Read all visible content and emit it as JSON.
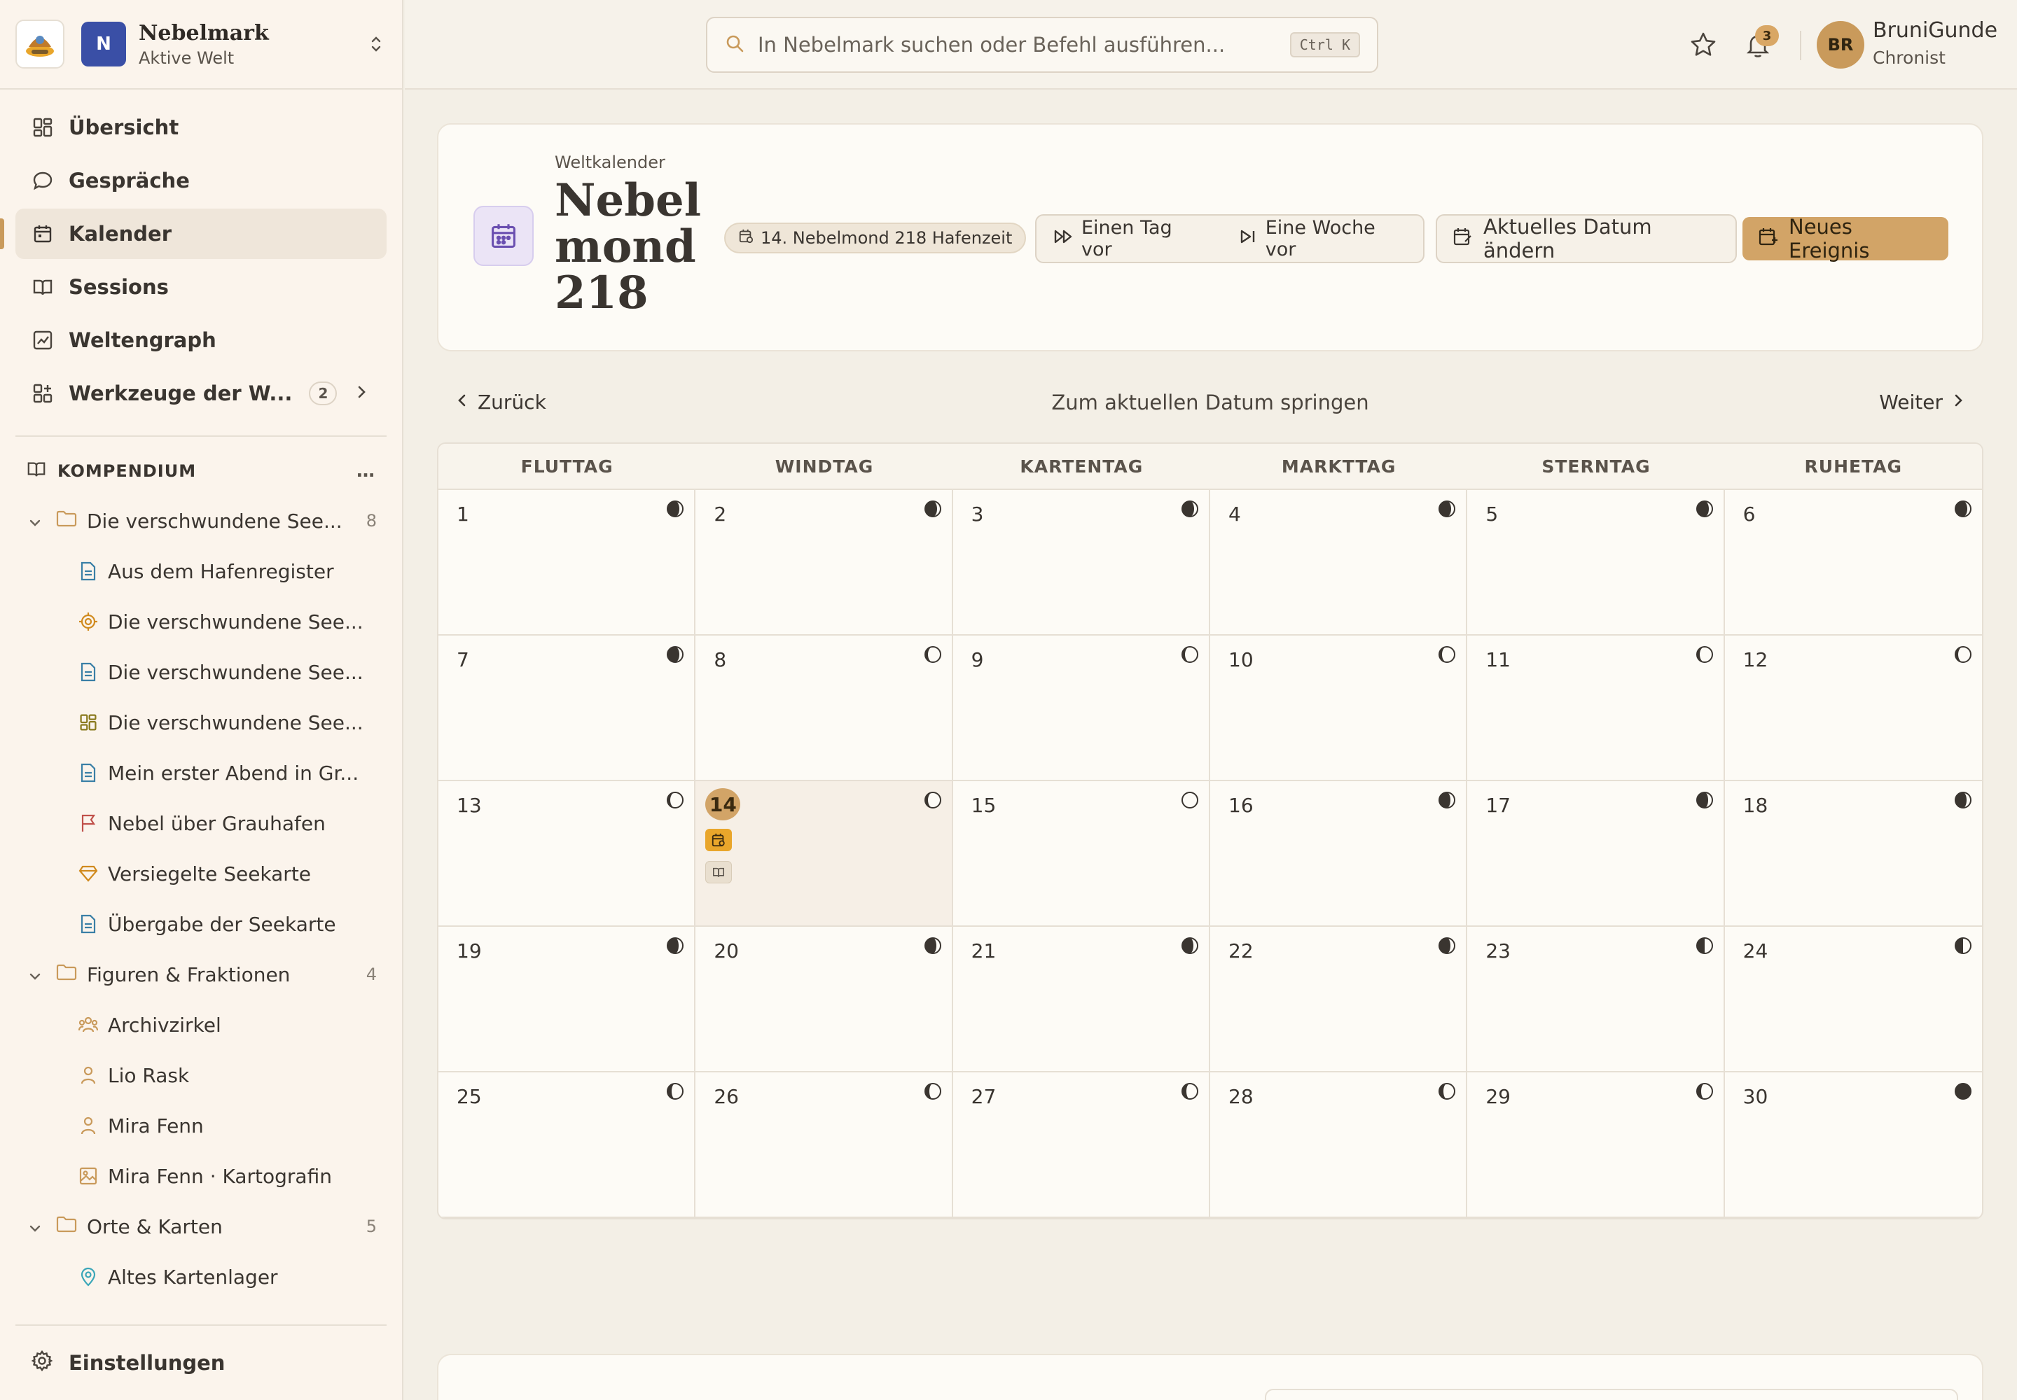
{
  "workspace": {
    "name": "Nebelmark",
    "subtitle": "Aktive Welt",
    "badge": "N"
  },
  "nav": {
    "items": [
      {
        "label": "Übersicht",
        "icon": "dashboard-icon"
      },
      {
        "label": "Gespräche",
        "icon": "chat-icon"
      },
      {
        "label": "Kalender",
        "icon": "calendar-icon",
        "active": true
      },
      {
        "label": "Sessions",
        "icon": "book-icon"
      },
      {
        "label": "Weltengraph",
        "icon": "graph-icon"
      },
      {
        "label": "Werkzeuge der W...",
        "icon": "tools-icon",
        "count": "2"
      }
    ],
    "settings": "Einstellungen"
  },
  "compendium": {
    "title": "KOMPENDIUM",
    "more": "…",
    "folders": [
      {
        "label": "Die verschwundene See...",
        "count": "8",
        "items": [
          {
            "label": "Aus dem Hafenregister",
            "icon": "document-icon",
            "color": "#3a7fa6"
          },
          {
            "label": "Die verschwundene See...",
            "icon": "target-icon",
            "color": "#d08a1e"
          },
          {
            "label": "Die verschwundene See...",
            "icon": "document-icon",
            "color": "#3a7fa6"
          },
          {
            "label": "Die verschwundene See...",
            "icon": "dashboard-icon",
            "color": "#8a7a1e"
          },
          {
            "label": "Mein erster Abend in Gr...",
            "icon": "document-icon",
            "color": "#3a7fa6"
          },
          {
            "label": "Nebel über Grauhafen",
            "icon": "flag-icon",
            "color": "#c0504a"
          },
          {
            "label": "Versiegelte Seekarte",
            "icon": "gem-icon",
            "color": "#d08a1e"
          },
          {
            "label": "Übergabe der Seekarte",
            "icon": "document-icon",
            "color": "#3a7fa6"
          }
        ]
      },
      {
        "label": "Figuren & Fraktionen",
        "count": "4",
        "items": [
          {
            "label": "Archivzirkel",
            "icon": "group-icon",
            "color": "#c99a5b"
          },
          {
            "label": "Lio Rask",
            "icon": "person-icon",
            "color": "#c99a5b"
          },
          {
            "label": "Mira Fenn",
            "icon": "person-icon",
            "color": "#c99a5b"
          },
          {
            "label": "Mira Fenn · Kartografin",
            "icon": "image-icon",
            "color": "#c99a5b"
          }
        ]
      },
      {
        "label": "Orte & Karten",
        "count": "5",
        "items": [
          {
            "label": "Altes Kartenlager",
            "icon": "map-pin-icon",
            "color": "#3aa6b8"
          }
        ]
      }
    ]
  },
  "topbar": {
    "search_placeholder": "In Nebelmark suchen oder Befehl ausführen...",
    "shortcut": "Ctrl K",
    "notifications": "3",
    "user": {
      "initials": "BR",
      "name": "BruniGunde",
      "role": "Chronist"
    }
  },
  "hero": {
    "kicker": "Weltkalender",
    "title": "Nebelmond 218",
    "date_pill": "14. Nebelmond 218 Hafenzeit",
    "btn_day": "Einen Tag vor",
    "btn_week": "Eine Woche vor",
    "btn_change": "Aktuelles Datum ändern",
    "btn_new": "Neues Ereignis"
  },
  "calendar": {
    "back": "Zurück",
    "today": "Zum aktuellen Datum springen",
    "next": "Weiter",
    "weekdays": [
      "FLUTTAG",
      "WINDTAG",
      "KARTENTAG",
      "MARKTTAG",
      "STERNTAG",
      "RUHETAG"
    ],
    "today_day": 14,
    "days": [
      {
        "n": "1",
        "moon": "waning-crescent"
      },
      {
        "n": "2",
        "moon": "waning-crescent"
      },
      {
        "n": "3",
        "moon": "waning-crescent"
      },
      {
        "n": "4",
        "moon": "waning-crescent"
      },
      {
        "n": "5",
        "moon": "waning-crescent"
      },
      {
        "n": "6",
        "moon": "waning-crescent"
      },
      {
        "n": "7",
        "moon": "waning-crescent"
      },
      {
        "n": "8",
        "moon": "waxing-crescent"
      },
      {
        "n": "9",
        "moon": "waxing-crescent"
      },
      {
        "n": "10",
        "moon": "waxing-crescent"
      },
      {
        "n": "11",
        "moon": "waxing-crescent"
      },
      {
        "n": "12",
        "moon": "waxing-crescent"
      },
      {
        "n": "13",
        "moon": "waxing-crescent"
      },
      {
        "n": "14",
        "moon": "waxing-crescent",
        "events": [
          "session-event-icon",
          "book-icon"
        ]
      },
      {
        "n": "15",
        "moon": "full"
      },
      {
        "n": "16",
        "moon": "waxing-gibbous"
      },
      {
        "n": "17",
        "moon": "waxing-gibbous"
      },
      {
        "n": "18",
        "moon": "waxing-gibbous"
      },
      {
        "n": "19",
        "moon": "waxing-gibbous"
      },
      {
        "n": "20",
        "moon": "waxing-gibbous"
      },
      {
        "n": "21",
        "moon": "waxing-gibbous"
      },
      {
        "n": "22",
        "moon": "waxing-gibbous"
      },
      {
        "n": "23",
        "moon": "last-quarter"
      },
      {
        "n": "24",
        "moon": "last-quarter"
      },
      {
        "n": "25",
        "moon": "waning-gibbous"
      },
      {
        "n": "26",
        "moon": "waning-gibbous"
      },
      {
        "n": "27",
        "moon": "waning-gibbous"
      },
      {
        "n": "28",
        "moon": "waning-gibbous"
      },
      {
        "n": "29",
        "moon": "waning-gibbous"
      },
      {
        "n": "30",
        "moon": "new"
      }
    ]
  },
  "colors": {
    "accent": "#d2a467",
    "sidebar_bg": "#fbf4ec",
    "page_bg": "#f3efe6",
    "badge_blue": "#3a4fa6"
  }
}
